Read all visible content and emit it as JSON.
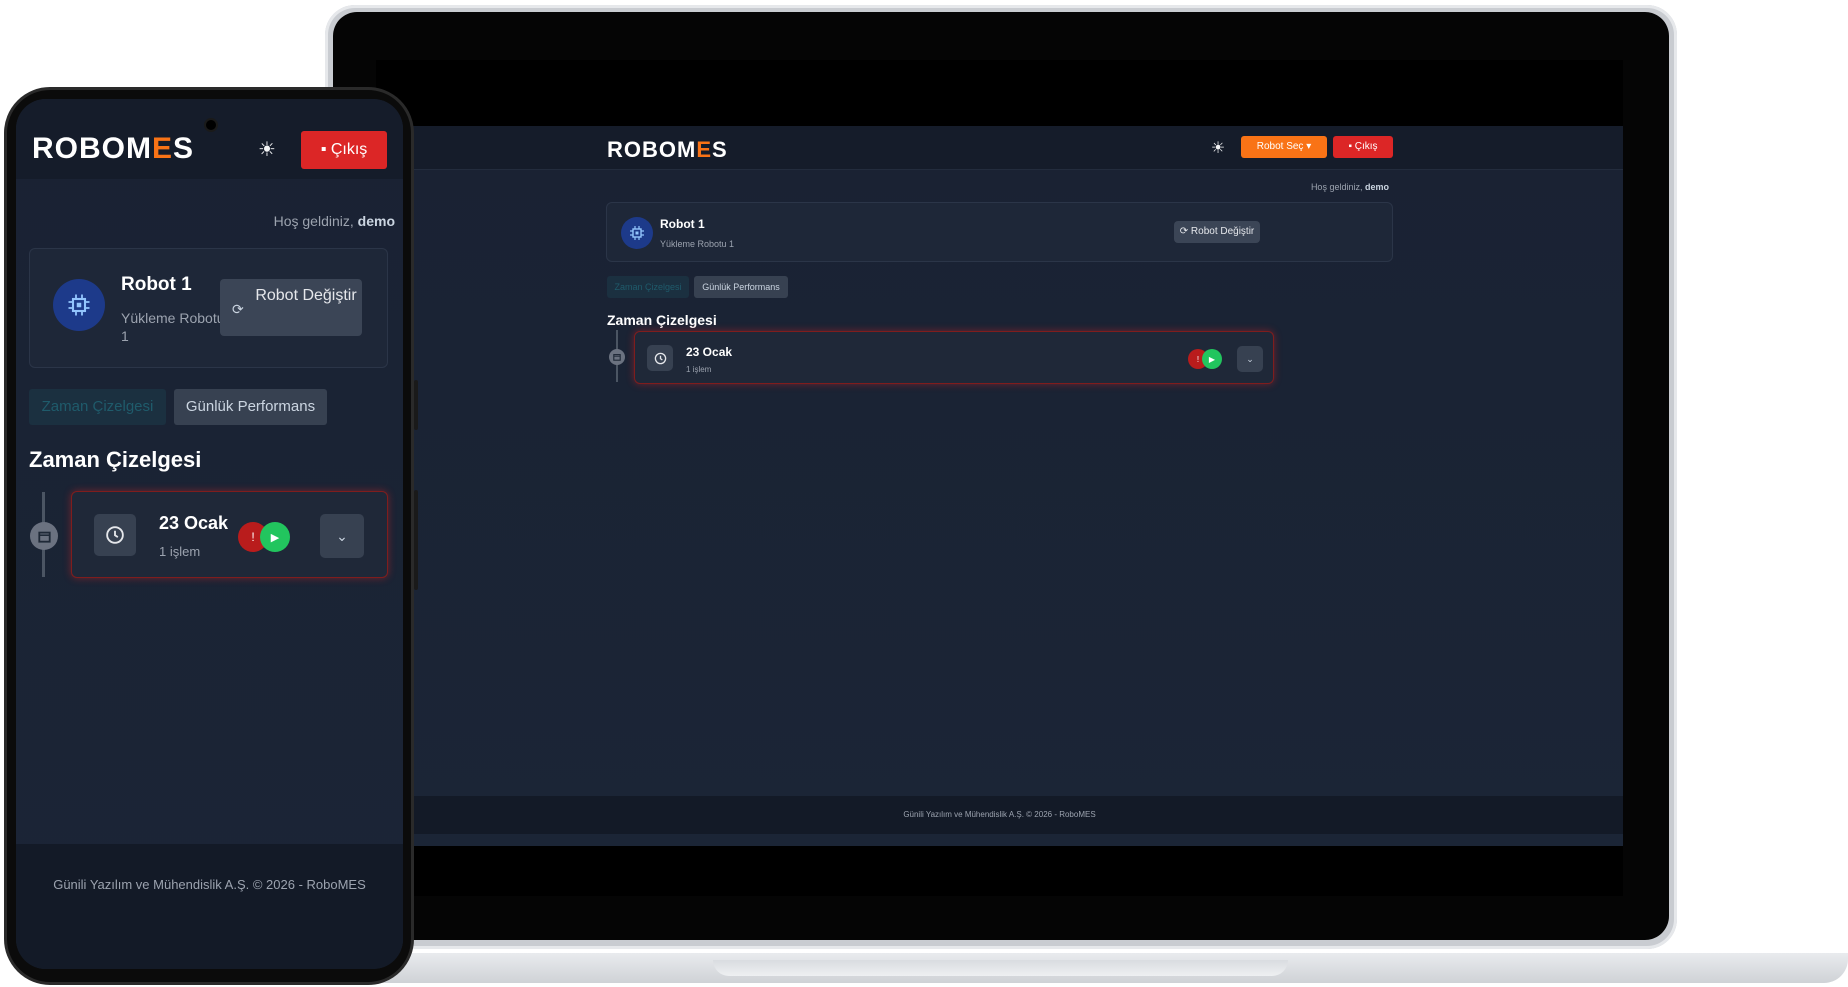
{
  "brand": {
    "logo_main": "ROBOM",
    "logo_e": "E",
    "logo_s": "S",
    "accent_color": "#f97316",
    "danger_color": "#dc2626"
  },
  "header": {
    "theme_icon": "☀",
    "robot_select_label": "Robot Seç",
    "robot_select_caret": "▾",
    "logout_icon": "▪",
    "logout_label": "Çıkış"
  },
  "welcome": {
    "prefix": "Hoş geldiniz,",
    "username": "demo"
  },
  "robot_card": {
    "icon": "chip-icon",
    "name": "Robot 1",
    "subtitle": "Yükleme Robotu 1",
    "change_icon": "⟳",
    "change_label": "Robot Değiştir"
  },
  "tabs": [
    {
      "label": "Zaman Çizelgesi",
      "active": true
    },
    {
      "label": "Günlük Performans",
      "active": false
    }
  ],
  "section": {
    "title": "Zaman Çizelgesi"
  },
  "timeline": [
    {
      "date": "23 Ocak",
      "count_label": "1 işlem",
      "status_error_icon": "!",
      "status_run_icon": "▶",
      "expand_icon": "⌄"
    }
  ],
  "footer": {
    "text": "Günili Yazılım ve Mühendislik A.Ş. © 2026 - RoboMES"
  }
}
